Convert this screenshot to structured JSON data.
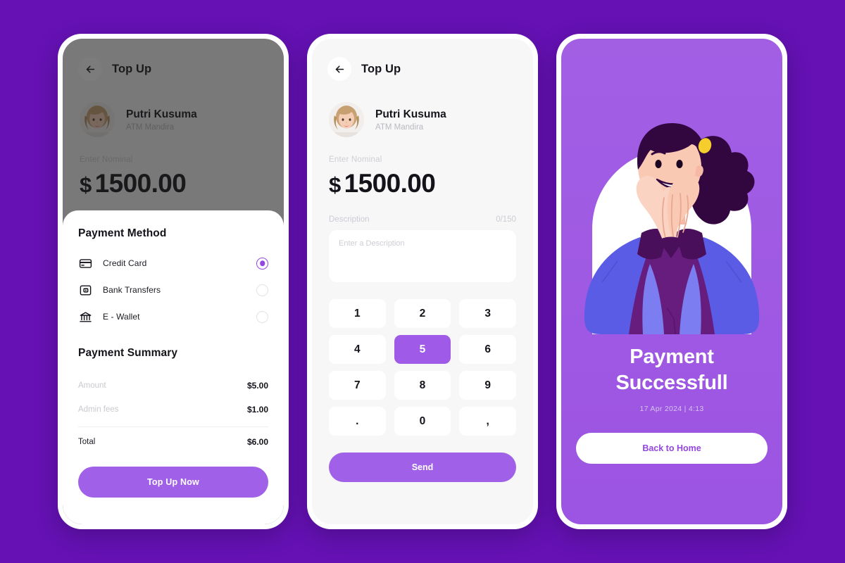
{
  "app": {
    "accent": "#9446E0",
    "accent_light": "#A160E8",
    "background": "#6511B4"
  },
  "screen1": {
    "appbar": {
      "title": "Top Up",
      "back_icon": "arrow-left-icon"
    },
    "profile": {
      "name": "Putri Kusuma",
      "bank": "ATM Mandira"
    },
    "nominal": {
      "label": "Enter Nominal",
      "currency": "$",
      "value": "1500.00"
    },
    "sheet": {
      "method_title": "Payment Method",
      "methods": [
        {
          "label": "Credit Card",
          "icon": "credit-card-icon",
          "selected": true
        },
        {
          "label": "Bank Transfers",
          "icon": "wallet-icon",
          "selected": false
        },
        {
          "label": "E - Wallet",
          "icon": "bank-icon",
          "selected": false
        }
      ],
      "summary_title": "Payment Summary",
      "summary": [
        {
          "key": "Amount",
          "value": "$5.00"
        },
        {
          "key": "Admin fees",
          "value": "$1.00"
        }
      ],
      "total": {
        "key": "Total",
        "value": "$6.00"
      },
      "cta_label": "Top Up Now"
    }
  },
  "screen2": {
    "appbar": {
      "title": "Top Up",
      "back_icon": "arrow-left-icon"
    },
    "profile": {
      "name": "Putri Kusuma",
      "bank": "ATM Mandira"
    },
    "nominal": {
      "label": "Enter Nominal",
      "currency": "$",
      "value": "1500.00"
    },
    "description": {
      "label": "Description",
      "counter": "0/150",
      "placeholder": "Enter a Description",
      "value": ""
    },
    "keypad": {
      "keys": [
        "1",
        "2",
        "3",
        "4",
        "5",
        "6",
        "7",
        "8",
        "9",
        ".",
        "0",
        ","
      ],
      "active_key": "5"
    },
    "send_label": "Send"
  },
  "screen3": {
    "title_line1": "Payment",
    "title_line2": "Successfull",
    "timestamp": "17 Apr 2024  |  4:13",
    "button_label": "Back to Home",
    "illustration": "happy-woman-illustration"
  }
}
